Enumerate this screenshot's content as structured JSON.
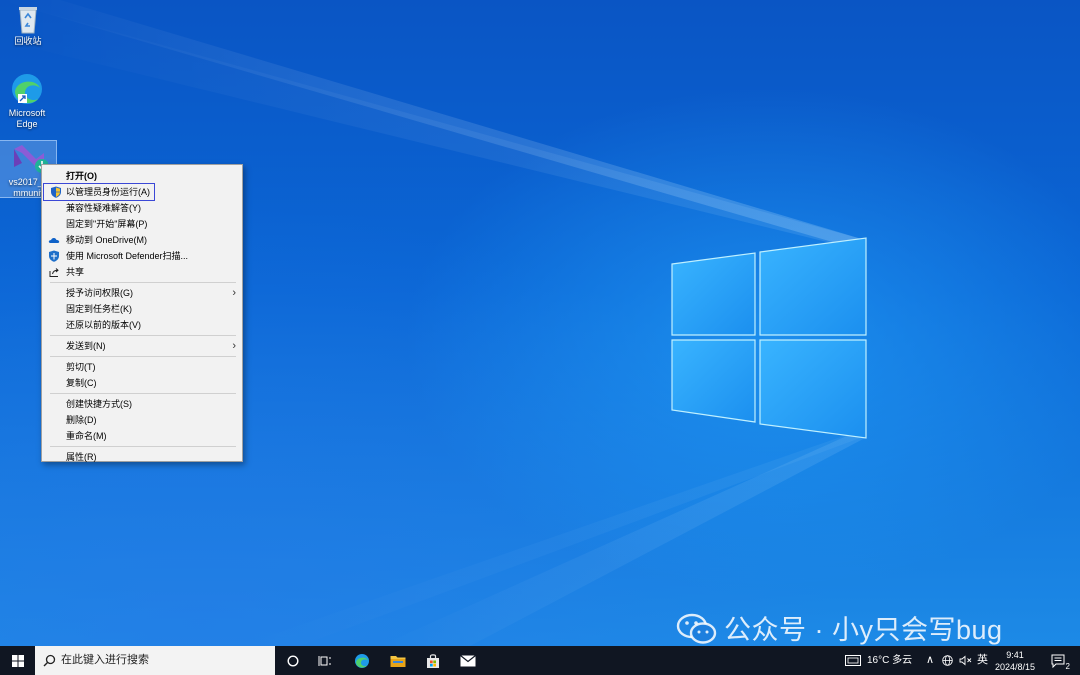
{
  "desktop": {
    "icons": [
      {
        "label": "回收站"
      },
      {
        "label_line1": "Microsoft",
        "label_line2": "Edge"
      },
      {
        "label_line1": "vs2017_c",
        "label_line2": "mmunit"
      }
    ]
  },
  "context_menu": {
    "items": [
      {
        "label": "打开(O)"
      },
      {
        "label": "以管理员身份运行(A)"
      },
      {
        "label": "兼容性疑难解答(Y)"
      },
      {
        "label": "固定到\"开始\"屏幕(P)"
      },
      {
        "label": "移动到 OneDrive(M)"
      },
      {
        "label": "使用 Microsoft Defender扫描..."
      },
      {
        "label": "共享"
      },
      {
        "label": "授予访问权限(G)"
      },
      {
        "label": "固定到任务栏(K)"
      },
      {
        "label": "还原以前的版本(V)"
      },
      {
        "label": "发送到(N)"
      },
      {
        "label": "剪切(T)"
      },
      {
        "label": "复制(C)"
      },
      {
        "label": "创建快捷方式(S)"
      },
      {
        "label": "删除(D)"
      },
      {
        "label": "重命名(M)"
      },
      {
        "label": "属性(R)"
      }
    ]
  },
  "watermark": {
    "text": "公众号 · 小y只会写bug"
  },
  "taskbar": {
    "search_placeholder": "在此键入进行搜索",
    "weather": "16°C 多云",
    "ime": "英",
    "time": "9:41",
    "date": "2024/8/15",
    "notification_count": "2"
  },
  "colors": {
    "highlight_box": "#3b48d6",
    "taskbar": "#101622"
  }
}
